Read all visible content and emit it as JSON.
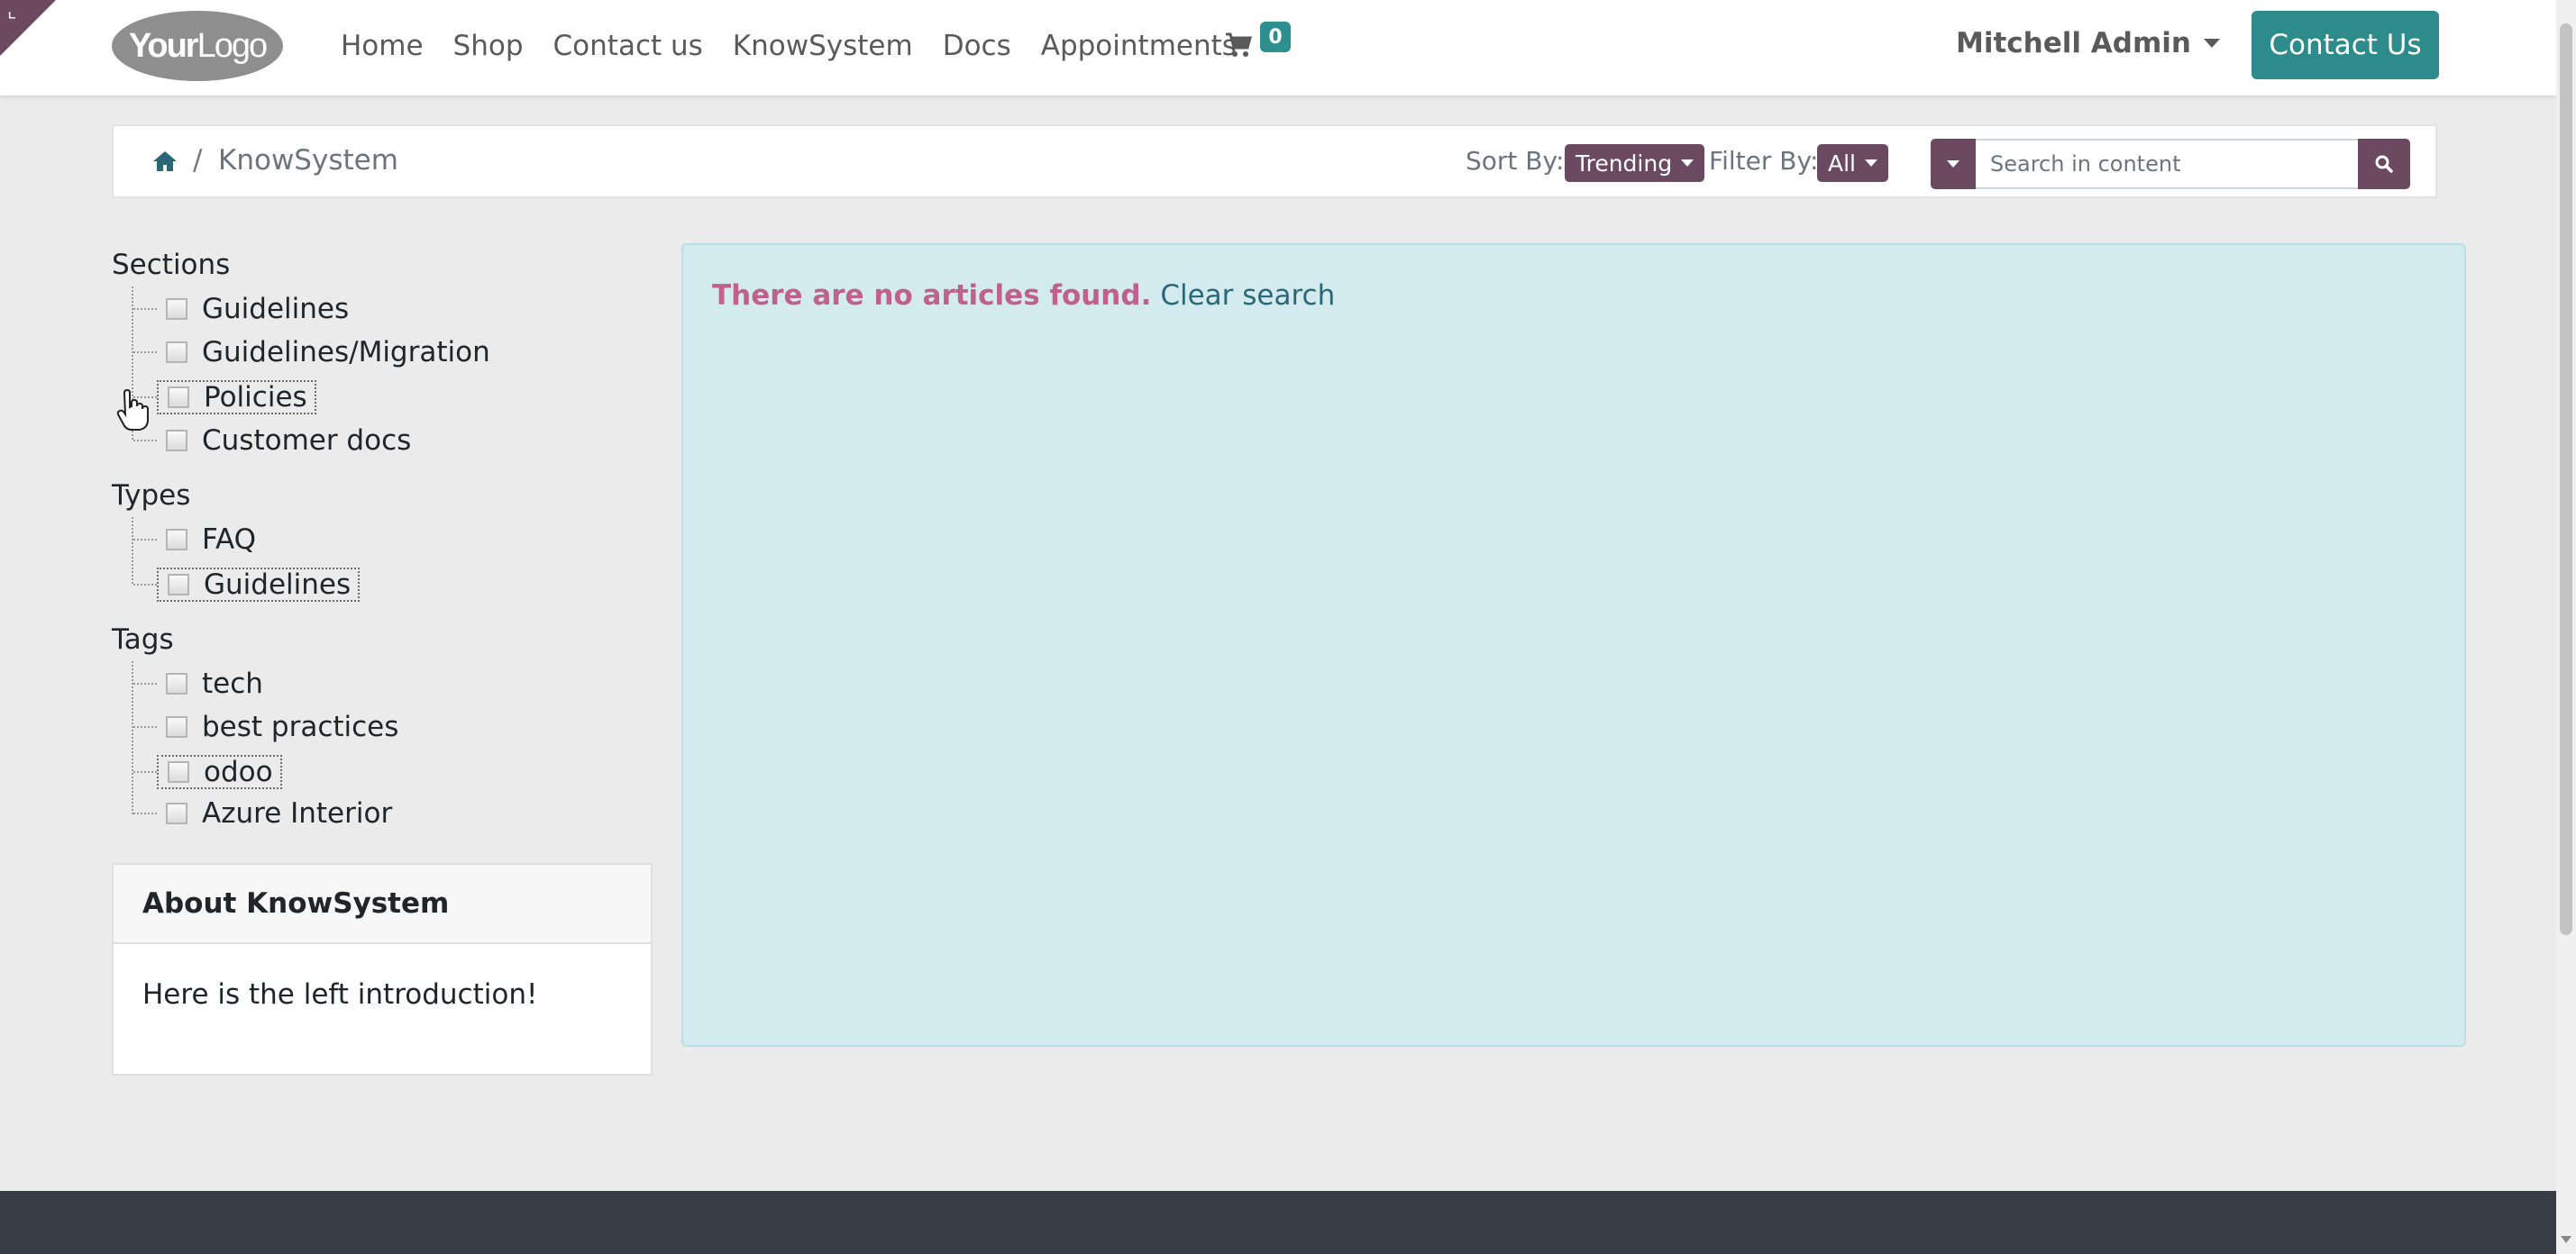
{
  "navbar": {
    "logo_bold": "Your",
    "logo_thin": "Logo",
    "links": [
      "Home",
      "Shop",
      "Contact us",
      "KnowSystem",
      "Docs",
      "Appointments"
    ],
    "cart_count": "0",
    "user_name": "Mitchell Admin",
    "cta_label": "Contact Us"
  },
  "breadcrumb": {
    "separator": "/",
    "current": "KnowSystem"
  },
  "toolbar": {
    "sort_label": "Sort By:",
    "sort_value": "Trending",
    "filter_label": "Filter By:",
    "filter_value": "All",
    "search_placeholder": "Search in content"
  },
  "sidebar": {
    "sections": {
      "title": "Sections",
      "items": [
        "Guidelines",
        "Guidelines/Migration",
        "Policies",
        "Customer docs"
      ]
    },
    "types": {
      "title": "Types",
      "items": [
        "FAQ",
        "Guidelines"
      ]
    },
    "tags": {
      "title": "Tags",
      "items": [
        "tech",
        "best practices",
        "odoo",
        "Azure Interior"
      ]
    },
    "about": {
      "title": "About KnowSystem",
      "body": "Here is the left introduction!"
    }
  },
  "main": {
    "empty_message": "There are no articles found.",
    "clear_link": "Clear search"
  },
  "colors": {
    "primary": "#6b4a61",
    "teal": "#2d8b8b",
    "alert_bg": "#d3ebef",
    "alert_text": "#c0618c",
    "footer": "#383c44"
  }
}
